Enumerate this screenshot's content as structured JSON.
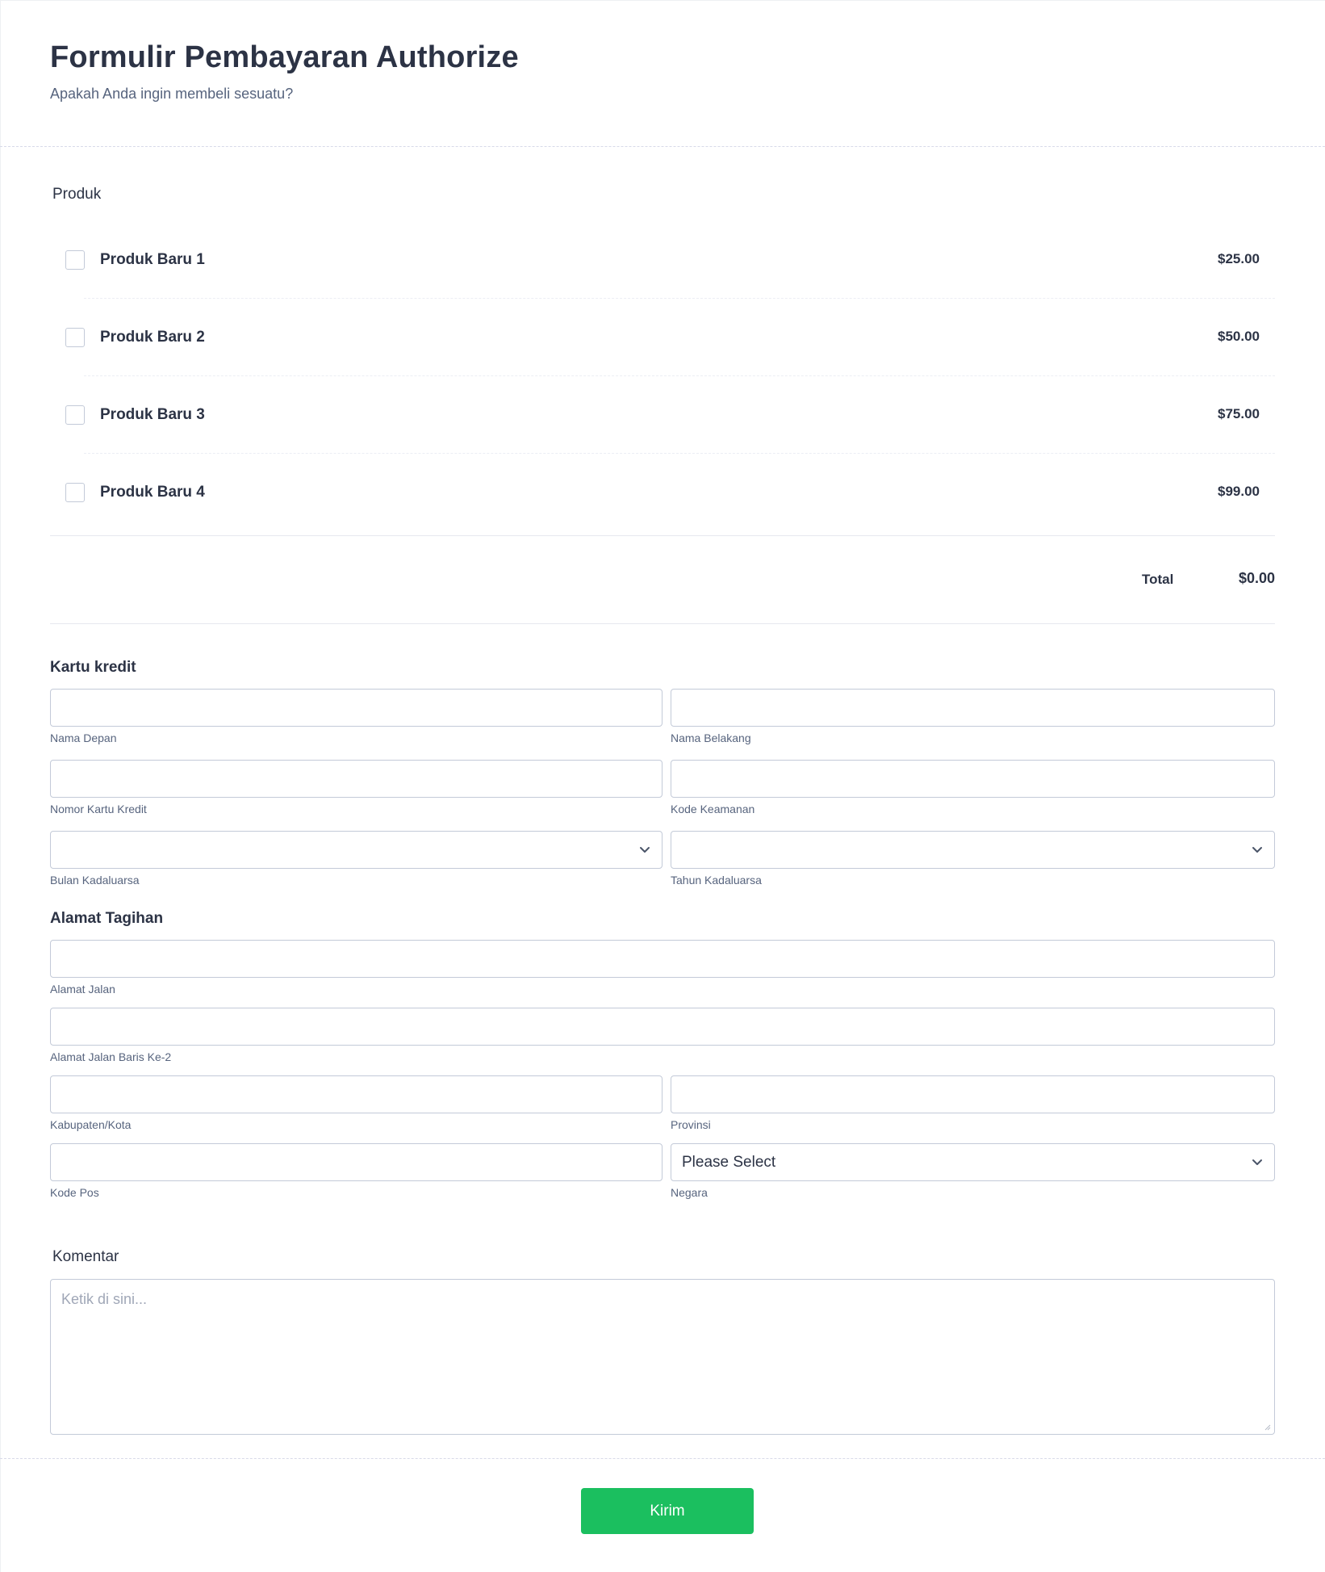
{
  "header": {
    "title": "Formulir Pembayaran Authorize",
    "subtitle": "Apakah Anda ingin membeli sesuatu?"
  },
  "products": {
    "label": "Produk",
    "items": [
      {
        "name": "Produk Baru 1",
        "price": "$25.00",
        "checked": false
      },
      {
        "name": "Produk Baru 2",
        "price": "$50.00",
        "checked": false
      },
      {
        "name": "Produk Baru 3",
        "price": "$75.00",
        "checked": false
      },
      {
        "name": "Produk Baru 4",
        "price": "$99.00",
        "checked": false
      }
    ],
    "total_label": "Total",
    "total_value": "$0.00"
  },
  "credit_card": {
    "heading": "Kartu kredit",
    "first_name": {
      "label": "Nama Depan",
      "value": ""
    },
    "last_name": {
      "label": "Nama Belakang",
      "value": ""
    },
    "card_number": {
      "label": "Nomor Kartu Kredit",
      "value": ""
    },
    "security_code": {
      "label": "Kode Keamanan",
      "value": ""
    },
    "exp_month": {
      "label": "Bulan Kadaluarsa",
      "selected": ""
    },
    "exp_year": {
      "label": "Tahun Kadaluarsa",
      "selected": ""
    }
  },
  "billing": {
    "heading": "Alamat Tagihan",
    "street": {
      "label": "Alamat Jalan",
      "value": ""
    },
    "street2": {
      "label": "Alamat Jalan Baris Ke-2",
      "value": ""
    },
    "city": {
      "label": "Kabupaten/Kota",
      "value": ""
    },
    "state": {
      "label": "Provinsi",
      "value": ""
    },
    "zip": {
      "label": "Kode Pos",
      "value": ""
    },
    "country": {
      "label": "Negara",
      "selected": "Please Select"
    }
  },
  "comment": {
    "label": "Komentar",
    "placeholder": "Ketik di sini..."
  },
  "submit": {
    "label": "Kirim",
    "color": "#1bbf5f"
  },
  "icons": {
    "select_chevron": "chevron-down-icon",
    "textarea_resize": "resize-handle-icon"
  }
}
